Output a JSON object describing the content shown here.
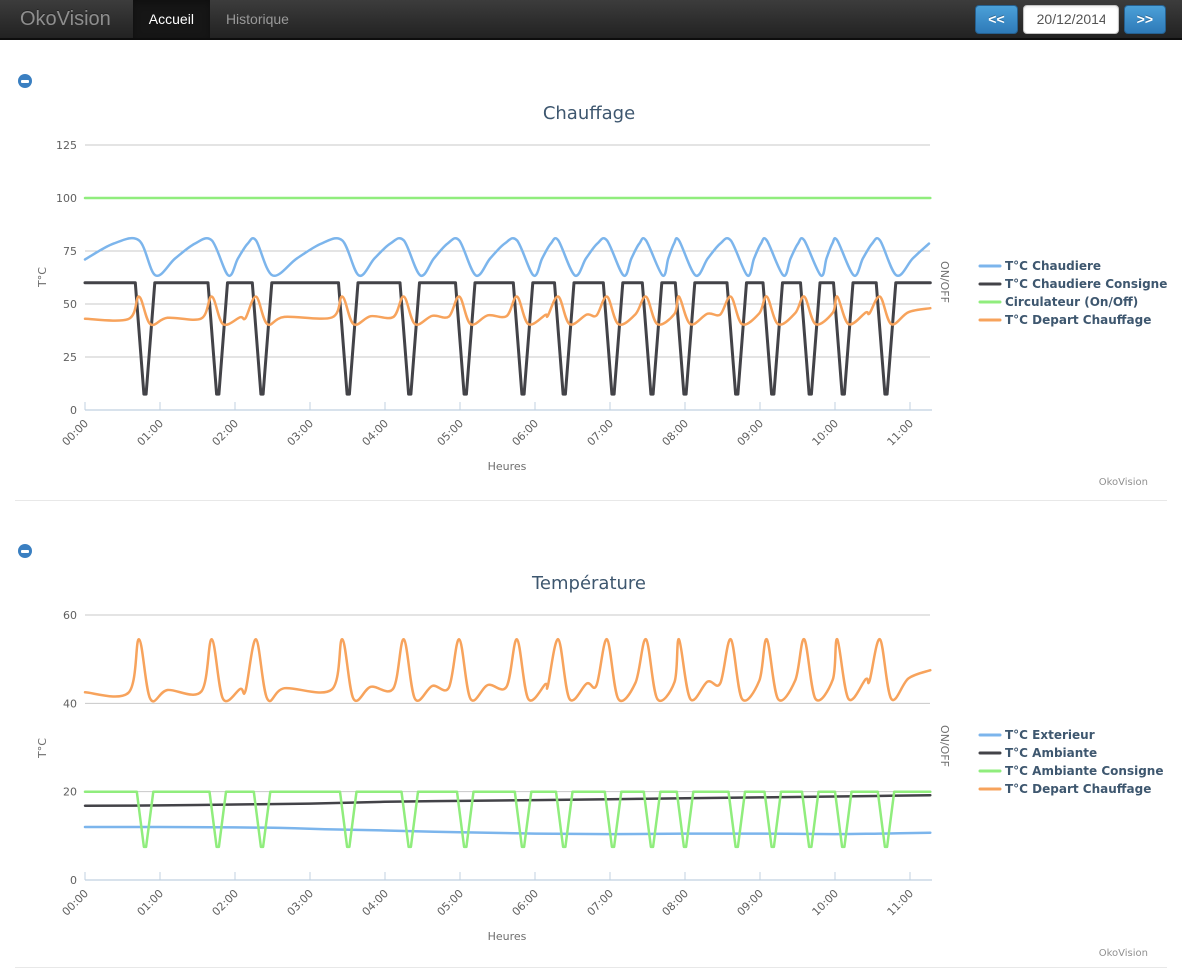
{
  "navbar": {
    "brand": "OkoVision",
    "tabs": [
      {
        "label": "Accueil",
        "active": true
      },
      {
        "label": "Historique",
        "active": false
      }
    ],
    "date_nav": {
      "prev": "<<",
      "date": "20/12/2014",
      "next": ">>"
    }
  },
  "style_colors": {
    "series_blue": "#7CB5EC",
    "series_dark": "#434348",
    "series_green": "#90ED7D",
    "series_orange": "#F7A35C",
    "grid": "#C8C8C8",
    "axis_line": "#C0D0E0",
    "tick_label": "#606060",
    "axis_title": "#6E6E6E",
    "chart_title": "#3E576F",
    "legend_text": "#3E576F",
    "credits": "#909090",
    "button_blue": "#3987c9"
  },
  "chart_data": [
    {
      "type": "line",
      "title": "Chauffage",
      "xlabel": "Heures",
      "ylabel": "T°C",
      "y2label": "ON/OFF",
      "credits": "OkoVision",
      "legend_position": "right",
      "grid": true,
      "x_hours_ticks": [
        "00:00",
        "01:00",
        "02:00",
        "03:00",
        "04:00",
        "05:00",
        "06:00",
        "07:00",
        "08:00",
        "09:00",
        "10:00",
        "11:00"
      ],
      "x_range_h": [
        0,
        11.27
      ],
      "ylim": [
        0,
        125
      ],
      "yticks": [
        0,
        25,
        50,
        75,
        100,
        125
      ],
      "cycle_starts_h": [
        0.8,
        1.77,
        2.36,
        3.51,
        4.33,
        5.07,
        5.84,
        6.39,
        7.04,
        7.56,
        8.0,
        8.69,
        9.17,
        9.67,
        10.11,
        10.68
      ],
      "series": [
        {
          "name": "T°C Chaudiere",
          "color": "#7CB5EC",
          "shape": "boiler",
          "start_value": 71,
          "min": 63.5,
          "max": 80,
          "smooth": true
        },
        {
          "name": "T°C Chaudiere Consigne",
          "color": "#434348",
          "shape": "dips",
          "level": 60,
          "dip_value": 7.5,
          "dip_half_width_h": 0.13,
          "width": 3,
          "smooth": false
        },
        {
          "name": "Circulateur (On/Off)",
          "color": "#90ED7D",
          "shape": "flat",
          "level": 100,
          "smooth": false
        },
        {
          "name": "T°C Depart Chauffage",
          "color": "#F7A35C",
          "shape": "spikes",
          "baseline": [
            [
              0,
              43
            ],
            [
              11.27,
              46
            ]
          ],
          "peak": 53.5,
          "post_dip": 40.5,
          "smooth": true
        }
      ]
    },
    {
      "type": "line",
      "title": "Température",
      "xlabel": "Heures",
      "ylabel": "T°C",
      "y2label": "ON/OFF",
      "credits": "OkoVision",
      "legend_position": "right",
      "grid": true,
      "x_hours_ticks": [
        "00:00",
        "01:00",
        "02:00",
        "03:00",
        "04:00",
        "05:00",
        "06:00",
        "07:00",
        "08:00",
        "09:00",
        "10:00",
        "11:00"
      ],
      "x_range_h": [
        0,
        11.27
      ],
      "ylim": [
        0,
        60
      ],
      "yticks": [
        0,
        20,
        40,
        60
      ],
      "cycle_starts_h": [
        0.8,
        1.77,
        2.36,
        3.51,
        4.33,
        5.07,
        5.84,
        6.39,
        7.04,
        7.56,
        8.0,
        8.69,
        9.17,
        9.67,
        10.11,
        10.68
      ],
      "series": [
        {
          "name": "T°C Exterieur",
          "color": "#7CB5EC",
          "shape": "points",
          "smooth": true,
          "points": [
            [
              0,
              12
            ],
            [
              1,
              12
            ],
            [
              2,
              11.9
            ],
            [
              2.6,
              11.8
            ],
            [
              3.2,
              11.5
            ],
            [
              4,
              11.2
            ],
            [
              5,
              10.8
            ],
            [
              6,
              10.5
            ],
            [
              7,
              10.4
            ],
            [
              8,
              10.5
            ],
            [
              9,
              10.5
            ],
            [
              10,
              10.4
            ],
            [
              10.6,
              10.5
            ],
            [
              11.27,
              10.7
            ]
          ]
        },
        {
          "name": "T°C Ambiante",
          "color": "#434348",
          "shape": "points",
          "smooth": true,
          "points": [
            [
              0,
              16.8
            ],
            [
              1,
              16.9
            ],
            [
              2,
              17.1
            ],
            [
              3,
              17.3
            ],
            [
              4,
              17.7
            ],
            [
              5,
              17.9
            ],
            [
              6,
              18.1
            ],
            [
              7,
              18.3
            ],
            [
              8,
              18.5
            ],
            [
              9,
              18.7
            ],
            [
              10,
              18.9
            ],
            [
              11.27,
              19.2
            ]
          ]
        },
        {
          "name": "T°C Ambiante Consigne",
          "color": "#90ED7D",
          "shape": "dips",
          "level": 20,
          "dip_value": 7.5,
          "dip_half_width_h": 0.11,
          "smooth": false
        },
        {
          "name": "T°C Depart Chauffage",
          "color": "#F7A35C",
          "shape": "spikes",
          "baseline": [
            [
              0,
              42.5
            ],
            [
              11.27,
              45.5
            ]
          ],
          "peak": 54.5,
          "post_dip": 41,
          "smooth": true
        }
      ]
    }
  ]
}
